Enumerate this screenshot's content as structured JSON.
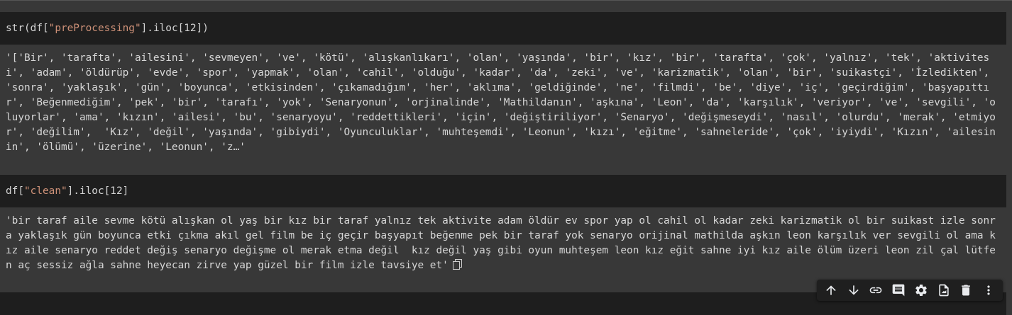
{
  "cell1": {
    "code_prefix": "str(df[",
    "code_string": "\"preProcessing\"",
    "code_suffix": "].iloc[12])",
    "output": "'['Bir', 'tarafta', 'ailesini', 'sevmeyen', 've', 'kötü', 'alışkanlıkarı', 'olan', 'yaşında', 'bir', 'kız', 'bir', 'tarafta', 'çok', 'yalnız', 'tek', 'aktivitesi', 'adam', 'öldürüp', 'evde', 'spor', 'yapmak', 'olan', 'cahil', 'olduğu', 'kadar', 'da', 'zeki', 've', 'karizmatik', 'olan', 'bir', 'suikastçi', 'İzledikten', 'sonra', 'yaklaşık', 'gün', 'boyunca', 'etkisinden', 'çıkamadığım', 'her', 'aklıma', 'geldiğinde', 'ne', 'filmdi', 'be', 'diye', 'iç', 'geçirdiğim', 'başyapıttır', 'Beğenmediğim', 'pek', 'bir', 'tarafı', 'yok', 'Senaryonun', 'orjinalinde', 'Mathildanın', 'aşkına', 'Leon', 'da', 'karşılık', 'veriyor', 've', 'sevgili', 'oluyorlar', 'ama', 'kızın', 'ailesi', 'bu', 'senaryoyu', 'reddettikleri', 'için', 'değiştiriliyor', 'Senaryo', 'değişmeseydi', 'nasıl', 'olurdu', 'merak', 'etmiyor', 'değilim',  'Kız', 'değil', 'yaşında', 'gibiydi', 'Oyunculuklar', 'muhteşemdi', 'Leonun', 'kızı', 'eğitme', 'sahneleride', 'çok', 'iyiydi', 'Kızın', 'ailesinin', 'ölümü', 'üzerine', 'Leonun', 'z…'"
  },
  "cell2": {
    "code_prefix": "df[",
    "code_string": "\"clean\"",
    "code_suffix": "].iloc[12]",
    "output": "'bir taraf aile sevme kötü alışkan ol yaş bir kız bir taraf yalnız tek aktivite adam öldür ev spor yap ol cahil ol kadar zeki karizmatik ol bir suikast izle sonra yaklaşık gün boyunca etki çıkma akıl gel film be iç geçir başyapıt beğenme pek bir taraf yok senaryo orijinal mathilda aşkın leon karşılık ver sevgili ol ama kız aile senaryo reddet değiş senaryo değişme ol merak etma değil  kız değil yaş gibi oyun muhteşem leon kız eğit sahne iyi kız aile ölüm üzeri leon zil çal lütfen aç sessiz ağla sahne heyecan zirve yap güzel bir film izle tavsiye et'"
  },
  "toolbar": {
    "icons": [
      "arrow-up-icon",
      "arrow-down-icon",
      "link-icon",
      "comment-icon",
      "gear-icon",
      "mirror-cell-icon",
      "trash-icon",
      "more-vert-icon"
    ]
  },
  "colors": {
    "string_literal": "#ce9178",
    "code_bg": "#1e1e1e",
    "output_bg": "#383838"
  }
}
